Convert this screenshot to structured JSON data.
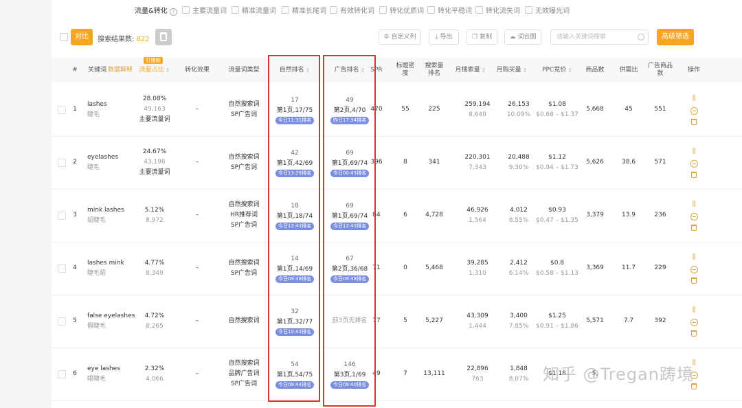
{
  "filters": {
    "title": "流量&转化",
    "options": [
      "主要流量词",
      "精准流量词",
      "精准长尾词",
      "有效转化词",
      "转化优质词",
      "转化平稳词",
      "转化流失词",
      "无效曝光词"
    ]
  },
  "toolbar": {
    "orange_btn": "对比",
    "count_label": "搜索结果数: ",
    "count_value": "822",
    "custom_cols": "自定义列",
    "export": "导出",
    "copy": "复制",
    "word_cloud": "词云图",
    "search_placeholder": "请输入关键词搜索",
    "advanced_filter": "高级筛选"
  },
  "headers": {
    "num": "#",
    "keyword": "关键词",
    "keyword_link": "数据解释",
    "hot_badge": "打爆款",
    "flow_share": "流量占比",
    "conversion": "转化效果",
    "traffic_type": "流量词类型",
    "organic_rank": "自然排名",
    "ad_rank": "广告排名",
    "spr": "SPR",
    "title_density": "标题密度",
    "search_rank": "搜索量排名",
    "monthly_search": "月搜索量",
    "monthly_buy": "月购买量",
    "ppc": "PPC竞价",
    "product_count": "商品数",
    "supply_demand": "供需比",
    "ad_products": "广告商品数",
    "actions": "操作"
  },
  "rows": [
    {
      "num": "1",
      "kw": "lashes",
      "kw_cn": "睫毛",
      "share": "28.08%",
      "share_sub": "49,163",
      "share_tag": "主要流量词",
      "conv": "–",
      "types": [
        "自然搜索词",
        "SP广告词"
      ],
      "org": [
        "17",
        "第1页,17/75",
        "今日11:31排名"
      ],
      "ad": [
        "49",
        "第2页,4/70",
        "昨日17:34排名"
      ],
      "spr": "470",
      "density": "55",
      "srank": "225",
      "ms": "259,194",
      "ms_sub": "8,640",
      "mb": "26,153",
      "mb_sub": "10.09%",
      "ppc": "$1.08",
      "ppc_sub": "$0.68 – $1.37",
      "pc": "5,668",
      "sd": "45",
      "ap": "551"
    },
    {
      "num": "2",
      "kw": "eyelashes",
      "kw_cn": "睫毛",
      "share": "24.67%",
      "share_sub": "43,196",
      "share_tag": "主要流量词",
      "conv": "–",
      "types": [
        "自然搜索词",
        "SP广告词"
      ],
      "org": [
        "42",
        "第1页,42/69",
        "今日13:29排名"
      ],
      "ad": [
        "69",
        "第1页,69/74",
        "今日00:43排名"
      ],
      "spr": "396",
      "density": "8",
      "srank": "341",
      "ms": "220,301",
      "ms_sub": "7,343",
      "mb": "20,488",
      "mb_sub": "9.30%",
      "ppc": "$1.12",
      "ppc_sub": "$0.94 – $1.73",
      "pc": "5,626",
      "sd": "38.6",
      "ap": "571"
    },
    {
      "num": "3",
      "kw": "mink lashes",
      "kw_cn": "貂睫毛",
      "share": "5.12%",
      "share_sub": "8,972",
      "share_tag": "",
      "conv": "–",
      "types": [
        "自然搜索词",
        "HR推荐词",
        "SP广告词"
      ],
      "org": [
        "18",
        "第1页,18/74",
        "今日12:43排名"
      ],
      "ad": [
        "69",
        "第1页,69/74",
        "今日12:43排名"
      ],
      "spr": "84",
      "density": "6",
      "srank": "4,728",
      "ms": "46,926",
      "ms_sub": "1,564",
      "mb": "4,012",
      "mb_sub": "8.55%",
      "ppc": "$0.93",
      "ppc_sub": "$0.47 – $1.35",
      "pc": "3,379",
      "sd": "13.9",
      "ap": "236"
    },
    {
      "num": "4",
      "kw": "lashes mink",
      "kw_cn": "睫毛貂",
      "share": "4.77%",
      "share_sub": "8,349",
      "share_tag": "",
      "conv": "–",
      "types": [
        "自然搜索词",
        "SP广告词"
      ],
      "org": [
        "14",
        "第1页,14/69",
        "今日09:38排名"
      ],
      "ad": [
        "67",
        "第2页,36/68",
        "今日09:38排名"
      ],
      "spr": "71",
      "density": "0",
      "srank": "5,468",
      "ms": "39,285",
      "ms_sub": "1,310",
      "mb": "2,412",
      "mb_sub": "6.14%",
      "ppc": "$0.8",
      "ppc_sub": "$0.58 – $1.13",
      "pc": "3,369",
      "sd": "11.7",
      "ap": "229"
    },
    {
      "num": "5",
      "kw": "false eyelashes",
      "kw_cn": "假睫毛",
      "share": "4.72%",
      "share_sub": "8,265",
      "share_tag": "",
      "conv": "–",
      "types": [
        "自然搜索词"
      ],
      "org": [
        "32",
        "第1页,32/77",
        "今日10:43排名"
      ],
      "ad": [
        "前3页无排名",
        "",
        ""
      ],
      "spr": "77",
      "density": "5",
      "srank": "5,227",
      "ms": "43,309",
      "ms_sub": "1,444",
      "mb": "3,400",
      "mb_sub": "7.85%",
      "ppc": "$1.25",
      "ppc_sub": "$0.91 – $1.86",
      "pc": "5,571",
      "sd": "7.7",
      "ap": "392"
    },
    {
      "num": "6",
      "kw": "eye lashes",
      "kw_cn": "眼睫毛",
      "share": "2.32%",
      "share_sub": "4,066",
      "share_tag": "",
      "conv": "–",
      "types": [
        "自然搜索词",
        "品牌广告词",
        "SP广告词"
      ],
      "org": [
        "54",
        "第1页,54/75",
        "今日09:44排名"
      ],
      "ad": [
        "146",
        "第3页,1/69",
        "今日09:40排名"
      ],
      "spr": "49",
      "density": "7",
      "srank": "13,111",
      "ms": "22,896",
      "ms_sub": "763",
      "mb": "1,848",
      "mb_sub": "8.07%",
      "ppc": "$1.18",
      "ppc_sub": "",
      "pc": "5,",
      "sd": "",
      "ap": ""
    }
  ],
  "watermark": "知乎 @Tregan踌境",
  "colors": {
    "accent": "#f5a623",
    "pill": "#7b8fe0",
    "highlight_box": "#d9342b"
  }
}
